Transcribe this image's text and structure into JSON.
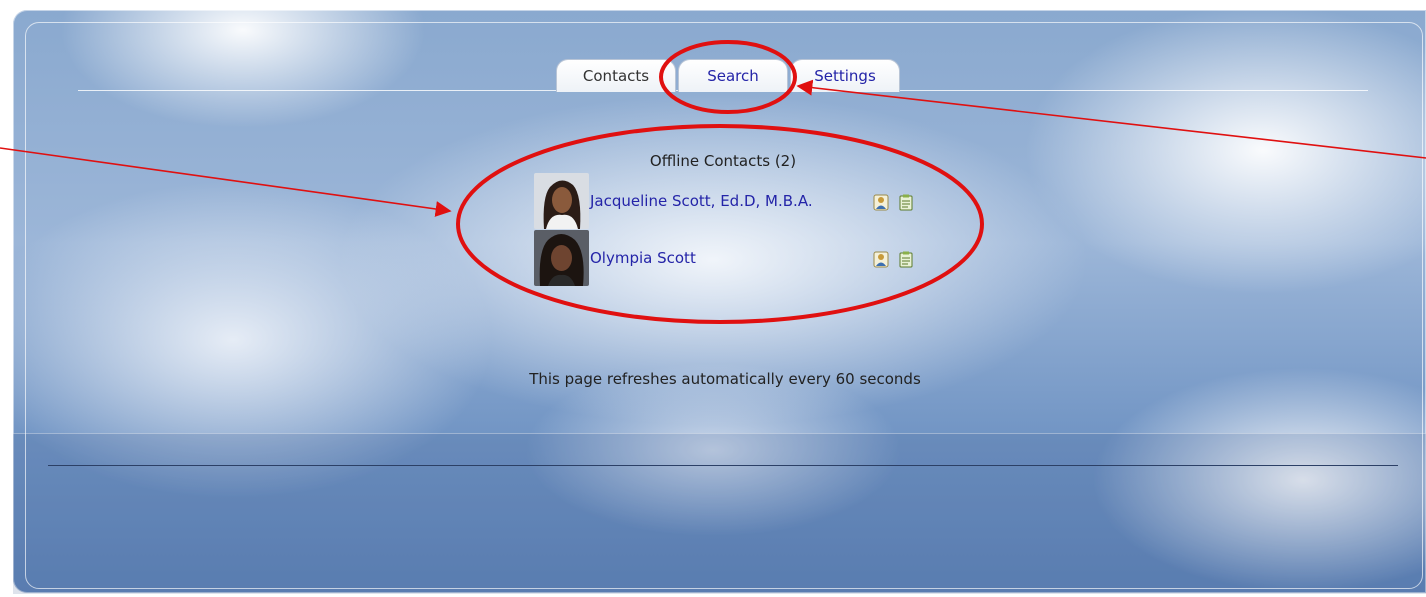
{
  "tabs": [
    {
      "label": "Contacts"
    },
    {
      "label": "Search"
    },
    {
      "label": "Settings"
    }
  ],
  "offline_section": {
    "title": "Offline Contacts (2)",
    "contacts": [
      {
        "name": "Jacqueline Scott, Ed.D, M.B.A."
      },
      {
        "name": "Olympia Scott"
      }
    ]
  },
  "refresh_note": "This page refreshes automatically every 60 seconds",
  "icons": {
    "profile": "profile-icon",
    "notes": "notes-icon"
  },
  "colors": {
    "link": "#2424a8",
    "annotation": "#e01010"
  }
}
